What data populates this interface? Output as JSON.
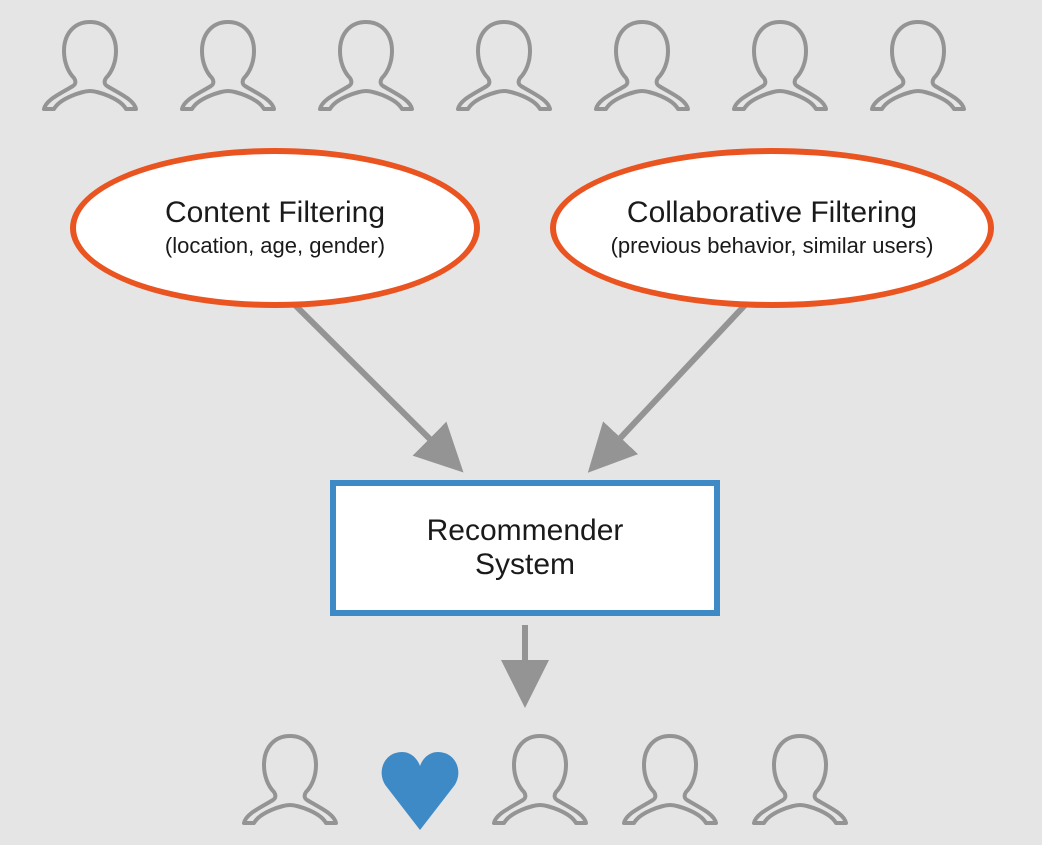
{
  "diagram": {
    "content_filter": {
      "title": "Content Filtering",
      "subtitle": "(location, age, gender)"
    },
    "collab_filter": {
      "title": "Collaborative Filtering",
      "subtitle": "(previous behavior, similar users)"
    },
    "recommender": {
      "line1": "Recommender",
      "line2": "System"
    },
    "colors": {
      "ellipse_border": "#e95420",
      "box_border": "#3e8ac6",
      "arrow": "#949494",
      "silhouette": "#949494",
      "heart": "#3e8ac6",
      "background": "#e5e5e5"
    },
    "layout": {
      "top_user_count": 7,
      "bottom_left_user_count": 1,
      "bottom_right_user_count": 3
    }
  }
}
